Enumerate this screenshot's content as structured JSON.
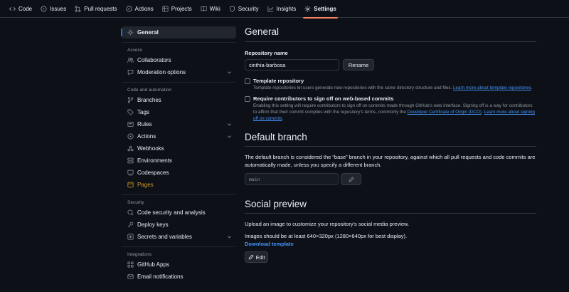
{
  "topnav": {
    "tabs": [
      {
        "label": "Code",
        "icon": "code-icon"
      },
      {
        "label": "Issues",
        "icon": "issue-icon"
      },
      {
        "label": "Pull requests",
        "icon": "pull-request-icon"
      },
      {
        "label": "Actions",
        "icon": "play-icon"
      },
      {
        "label": "Projects",
        "icon": "table-icon"
      },
      {
        "label": "Wiki",
        "icon": "book-icon"
      },
      {
        "label": "Security",
        "icon": "shield-icon"
      },
      {
        "label": "Insights",
        "icon": "graph-icon"
      },
      {
        "label": "Settings",
        "icon": "gear-icon"
      }
    ],
    "active_color": "#f78166"
  },
  "sidebar": {
    "general": "General",
    "access_heading": "Access",
    "collaborators": "Collaborators",
    "moderation": "Moderation options",
    "code_heading": "Code and automation",
    "branches": "Branches",
    "tags": "Tags",
    "rules": "Rules",
    "actions": "Actions",
    "webhooks": "Webhooks",
    "environments": "Environments",
    "codespaces": "Codespaces",
    "pages": "Pages",
    "security_heading": "Security",
    "code_security": "Code security and analysis",
    "deploy_keys": "Deploy keys",
    "secrets": "Secrets and variables",
    "integrations_heading": "Integrations",
    "github_apps": "GitHub Apps",
    "email": "Email notifications"
  },
  "general": {
    "title": "General",
    "repo_name_label": "Repository name",
    "repo_name_value": "cinthia-barbosa",
    "rename_button": "Rename",
    "template_label": "Template repository",
    "template_desc": "Template repositories let users generate new repositories with the same directory structure and files.",
    "template_link": "Learn more about template repositories",
    "signoff_label": "Require contributors to sign off on web-based commits",
    "signoff_desc": "Enabling this setting will require contributors to sign off on commits made through GitHub's web interface. Signing off is a way for contributors to affirm that their commit complies with the repository's terms, commonly the",
    "signoff_link1": "Developer Certificate of Origin (DCO)",
    "signoff_link2": "Learn more about signing off on commits"
  },
  "default_branch": {
    "title": "Default branch",
    "desc": "The default branch is considered the “base” branch in your repository, against which all pull requests and code commits are automatically made, unless you specify a different branch.",
    "value": "main"
  },
  "social_preview": {
    "title": "Social preview",
    "desc": "Upload an image to customize your repository's social media preview.",
    "size_note": "Images should be at least 640×320px (1280×640px for best display).",
    "download_link": "Download template",
    "edit_button": "Edit"
  }
}
